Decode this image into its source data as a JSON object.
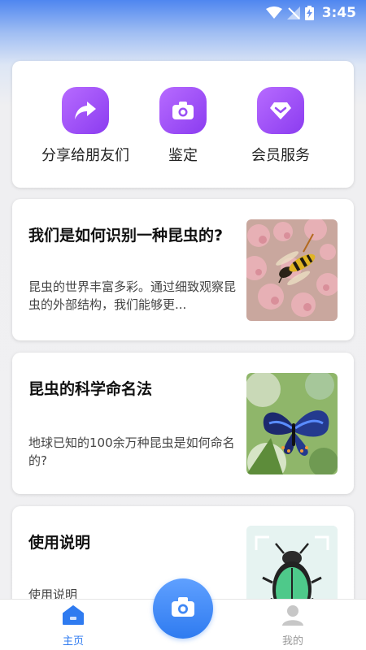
{
  "status_bar": {
    "time": "3:45"
  },
  "quick_actions": [
    {
      "label": "分享给朋友们",
      "icon": "share-icon"
    },
    {
      "label": "鉴定",
      "icon": "camera-icon"
    },
    {
      "label": "会员服务",
      "icon": "vip-diamond-icon"
    }
  ],
  "articles": [
    {
      "title": "我们是如何识别一种昆虫的?",
      "desc": "昆虫的世界丰富多彩。通过细致观察昆虫的外部结构，我们能够更...",
      "image": "wasp-on-flowers-photo"
    },
    {
      "title": "昆虫的科学命名法",
      "desc": "地球已知的100余万种昆虫是如何命名的?",
      "image": "butterfly-photo"
    },
    {
      "title": "使用说明",
      "desc": "使用说明",
      "image": "beetle-scan-illustration"
    }
  ],
  "tabbar": {
    "home_label": "主页",
    "mine_label": "我的",
    "active_color": "#2f7bf0",
    "inactive_color": "#999999"
  }
}
